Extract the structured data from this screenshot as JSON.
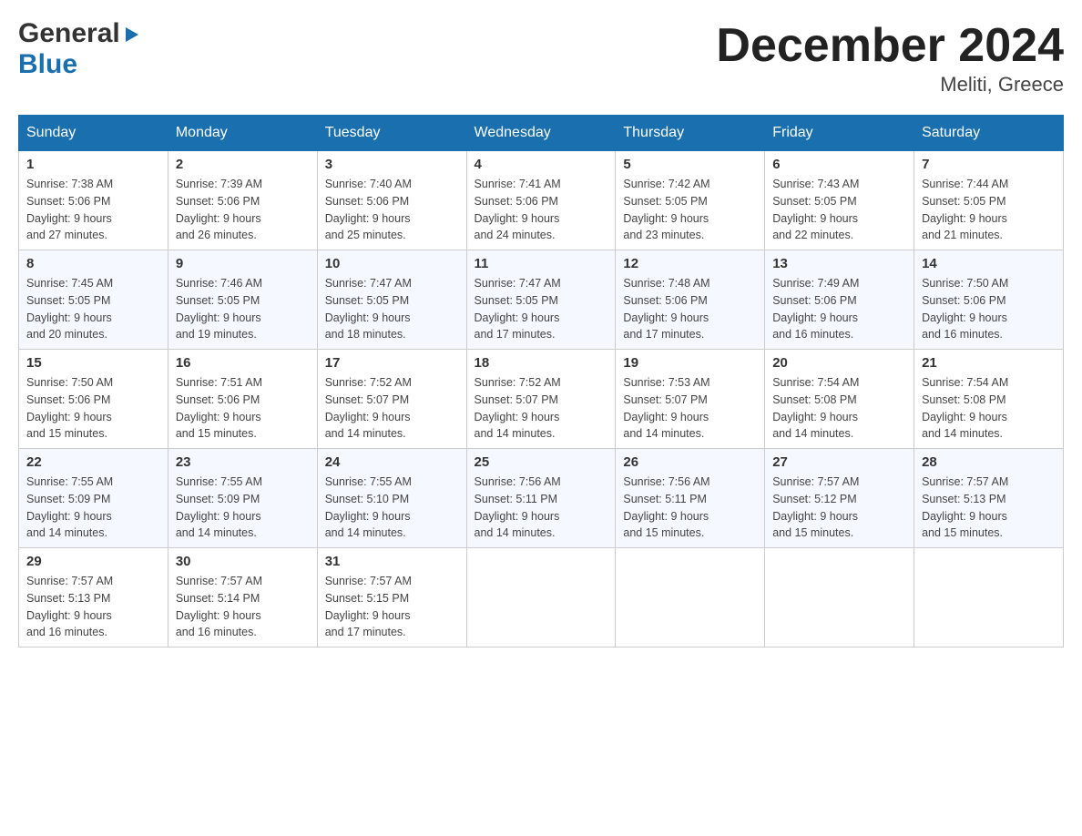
{
  "header": {
    "logo": {
      "general": "General",
      "blue": "Blue",
      "alt": "GeneralBlue logo"
    },
    "title": "December 2024",
    "location": "Meliti, Greece"
  },
  "calendar": {
    "days_of_week": [
      "Sunday",
      "Monday",
      "Tuesday",
      "Wednesday",
      "Thursday",
      "Friday",
      "Saturday"
    ],
    "weeks": [
      [
        {
          "day": "1",
          "sunrise": "7:38 AM",
          "sunset": "5:06 PM",
          "daylight": "9 hours and 27 minutes."
        },
        {
          "day": "2",
          "sunrise": "7:39 AM",
          "sunset": "5:06 PM",
          "daylight": "9 hours and 26 minutes."
        },
        {
          "day": "3",
          "sunrise": "7:40 AM",
          "sunset": "5:06 PM",
          "daylight": "9 hours and 25 minutes."
        },
        {
          "day": "4",
          "sunrise": "7:41 AM",
          "sunset": "5:06 PM",
          "daylight": "9 hours and 24 minutes."
        },
        {
          "day": "5",
          "sunrise": "7:42 AM",
          "sunset": "5:05 PM",
          "daylight": "9 hours and 23 minutes."
        },
        {
          "day": "6",
          "sunrise": "7:43 AM",
          "sunset": "5:05 PM",
          "daylight": "9 hours and 22 minutes."
        },
        {
          "day": "7",
          "sunrise": "7:44 AM",
          "sunset": "5:05 PM",
          "daylight": "9 hours and 21 minutes."
        }
      ],
      [
        {
          "day": "8",
          "sunrise": "7:45 AM",
          "sunset": "5:05 PM",
          "daylight": "9 hours and 20 minutes."
        },
        {
          "day": "9",
          "sunrise": "7:46 AM",
          "sunset": "5:05 PM",
          "daylight": "9 hours and 19 minutes."
        },
        {
          "day": "10",
          "sunrise": "7:47 AM",
          "sunset": "5:05 PM",
          "daylight": "9 hours and 18 minutes."
        },
        {
          "day": "11",
          "sunrise": "7:47 AM",
          "sunset": "5:05 PM",
          "daylight": "9 hours and 17 minutes."
        },
        {
          "day": "12",
          "sunrise": "7:48 AM",
          "sunset": "5:06 PM",
          "daylight": "9 hours and 17 minutes."
        },
        {
          "day": "13",
          "sunrise": "7:49 AM",
          "sunset": "5:06 PM",
          "daylight": "9 hours and 16 minutes."
        },
        {
          "day": "14",
          "sunrise": "7:50 AM",
          "sunset": "5:06 PM",
          "daylight": "9 hours and 16 minutes."
        }
      ],
      [
        {
          "day": "15",
          "sunrise": "7:50 AM",
          "sunset": "5:06 PM",
          "daylight": "9 hours and 15 minutes."
        },
        {
          "day": "16",
          "sunrise": "7:51 AM",
          "sunset": "5:06 PM",
          "daylight": "9 hours and 15 minutes."
        },
        {
          "day": "17",
          "sunrise": "7:52 AM",
          "sunset": "5:07 PM",
          "daylight": "9 hours and 14 minutes."
        },
        {
          "day": "18",
          "sunrise": "7:52 AM",
          "sunset": "5:07 PM",
          "daylight": "9 hours and 14 minutes."
        },
        {
          "day": "19",
          "sunrise": "7:53 AM",
          "sunset": "5:07 PM",
          "daylight": "9 hours and 14 minutes."
        },
        {
          "day": "20",
          "sunrise": "7:54 AM",
          "sunset": "5:08 PM",
          "daylight": "9 hours and 14 minutes."
        },
        {
          "day": "21",
          "sunrise": "7:54 AM",
          "sunset": "5:08 PM",
          "daylight": "9 hours and 14 minutes."
        }
      ],
      [
        {
          "day": "22",
          "sunrise": "7:55 AM",
          "sunset": "5:09 PM",
          "daylight": "9 hours and 14 minutes."
        },
        {
          "day": "23",
          "sunrise": "7:55 AM",
          "sunset": "5:09 PM",
          "daylight": "9 hours and 14 minutes."
        },
        {
          "day": "24",
          "sunrise": "7:55 AM",
          "sunset": "5:10 PM",
          "daylight": "9 hours and 14 minutes."
        },
        {
          "day": "25",
          "sunrise": "7:56 AM",
          "sunset": "5:11 PM",
          "daylight": "9 hours and 14 minutes."
        },
        {
          "day": "26",
          "sunrise": "7:56 AM",
          "sunset": "5:11 PM",
          "daylight": "9 hours and 15 minutes."
        },
        {
          "day": "27",
          "sunrise": "7:57 AM",
          "sunset": "5:12 PM",
          "daylight": "9 hours and 15 minutes."
        },
        {
          "day": "28",
          "sunrise": "7:57 AM",
          "sunset": "5:13 PM",
          "daylight": "9 hours and 15 minutes."
        }
      ],
      [
        {
          "day": "29",
          "sunrise": "7:57 AM",
          "sunset": "5:13 PM",
          "daylight": "9 hours and 16 minutes."
        },
        {
          "day": "30",
          "sunrise": "7:57 AM",
          "sunset": "5:14 PM",
          "daylight": "9 hours and 16 minutes."
        },
        {
          "day": "31",
          "sunrise": "7:57 AM",
          "sunset": "5:15 PM",
          "daylight": "9 hours and 17 minutes."
        },
        null,
        null,
        null,
        null
      ]
    ],
    "labels": {
      "sunrise": "Sunrise:",
      "sunset": "Sunset:",
      "daylight": "Daylight:"
    }
  }
}
